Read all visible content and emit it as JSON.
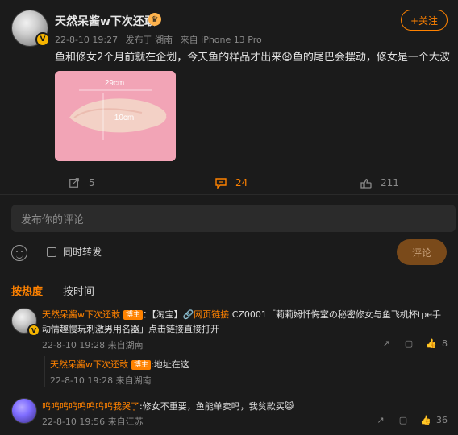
{
  "post": {
    "author": "天然呆酱w下次还敢",
    "crown_icon": "crown-icon",
    "follow_button": "+关注",
    "meta": {
      "date": "22-8-10 19:27",
      "location": "发布于 湖南",
      "device": "来自 iPhone 13 Pro"
    },
    "text": "鱼和修女2个月前就在企划，今天鱼的样品才出来😧鱼的尾巴会摆动，修女是一个大波",
    "image": {
      "label_top": "29cm",
      "label_mid": "10cm"
    },
    "actions": {
      "share_count": "5",
      "comment_count": "24",
      "like_count": "211"
    }
  },
  "composer": {
    "placeholder": "发布你的评论",
    "repost_label": "同时转发",
    "submit_label": "评论"
  },
  "sort_tabs": {
    "hot_label": "按热度",
    "time_label": "按时间"
  },
  "comments": [
    {
      "user": "天然呆酱w下次还敢",
      "tag": "博主",
      "text_prefix": "：【淘宝】",
      "link_icon": "link-icon",
      "link_text": "网页链接",
      "text_rest": " CZ0001「莉莉姆忏悔室の秘密修女与鱼飞机杯tpe手动情趣慢玩刺激男用名器」点击链接直接打开",
      "meta": "22-8-10 19:28 来自湖南",
      "like_count": "8",
      "reply": {
        "user": "天然呆酱w下次还敢",
        "tag": "博主",
        "text": ":地址在这",
        "meta": "22-8-10 19:28 来自湖南"
      }
    },
    {
      "user": "呜呜呜呜呜呜呜呜我哭了",
      "text": ":修女不重要，鱼能单卖吗，我贫款买😺",
      "meta": "22-8-10 19:56 来自江苏",
      "like_count": "36"
    }
  ],
  "colors": {
    "accent": "#ff8200",
    "bg": "#1b1b1b",
    "input_bg": "#2b2b2b"
  }
}
